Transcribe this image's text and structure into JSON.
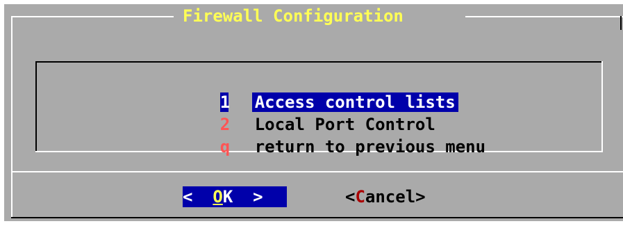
{
  "dialog": {
    "title": "Firewall Configuration"
  },
  "menu": {
    "items": [
      {
        "tag": "1",
        "label": "Access control lists",
        "selected": true
      },
      {
        "tag": "2",
        "label": "Local Port Control",
        "selected": false
      },
      {
        "tag": "q",
        "label": "return to previous menu",
        "selected": false
      }
    ]
  },
  "buttons": {
    "ok": {
      "left": "<  ",
      "hot": "O",
      "rest": "K",
      "right": "  >"
    },
    "cancel": {
      "left": "<",
      "hot": "C",
      "rest": "ancel",
      "right": ">"
    }
  },
  "colors": {
    "background": "#aaaaaa",
    "title": "#ffff55",
    "selection": "#0000aa",
    "tag": "#ff5555",
    "hotkey_cancel": "#aa0000"
  }
}
